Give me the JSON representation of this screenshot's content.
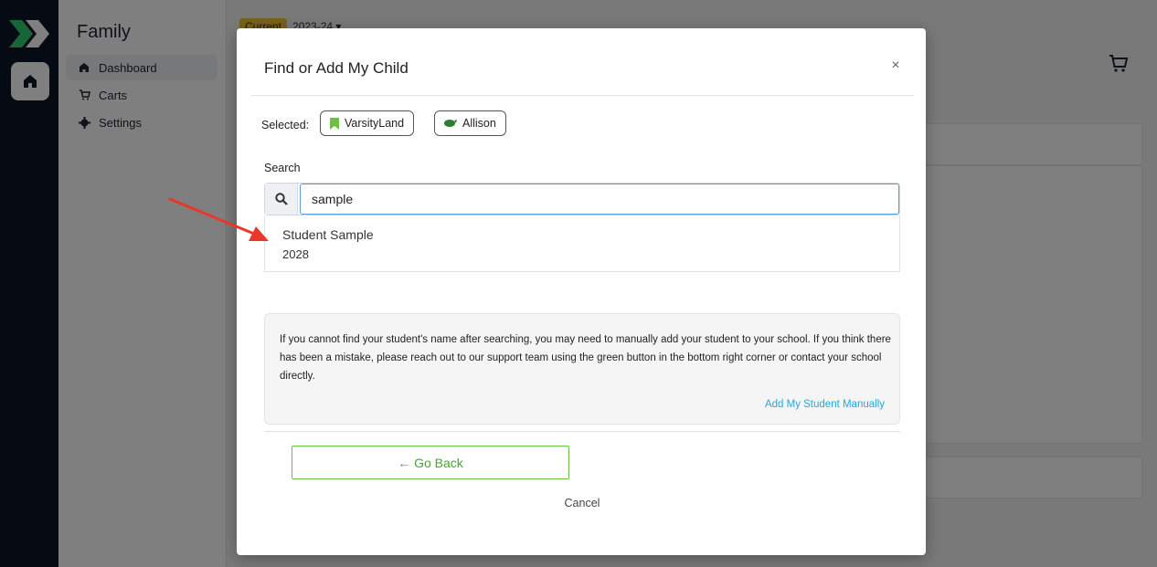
{
  "sidebar": {
    "title": "Family",
    "items": [
      {
        "label": "Dashboard",
        "icon": "home-icon"
      },
      {
        "label": "Carts",
        "icon": "cart-icon"
      },
      {
        "label": "Settings",
        "icon": "gear-icon"
      }
    ]
  },
  "topbar": {
    "badge": "Current",
    "season": "2023-24"
  },
  "modal": {
    "title": "Find or Add My Child",
    "close": "×",
    "selected_label": "Selected:",
    "chips": [
      {
        "label": "VarsityLand",
        "icon": "bookmark-icon",
        "color": "#6cc04a"
      },
      {
        "label": "Allison",
        "icon": "mascot-icon",
        "color": "#2e7d32"
      }
    ],
    "search_label": "Search",
    "search_value": "sample",
    "result": {
      "name": "Student Sample",
      "year": "2028"
    },
    "info_text": "If you cannot find your student's name after searching, you may need to manually add your student to your school. If you think there has been a mistake, please reach out to our support team using the green button in the bottom right corner or contact your school directly.",
    "info_link": "Add My Student Manually",
    "go_back": "← Go Back",
    "cancel": "Cancel"
  },
  "colors": {
    "rail": "#0a1426",
    "accent_green": "#6cc04a",
    "link_blue": "#23a7e0",
    "annotation_red": "#e8382b"
  }
}
